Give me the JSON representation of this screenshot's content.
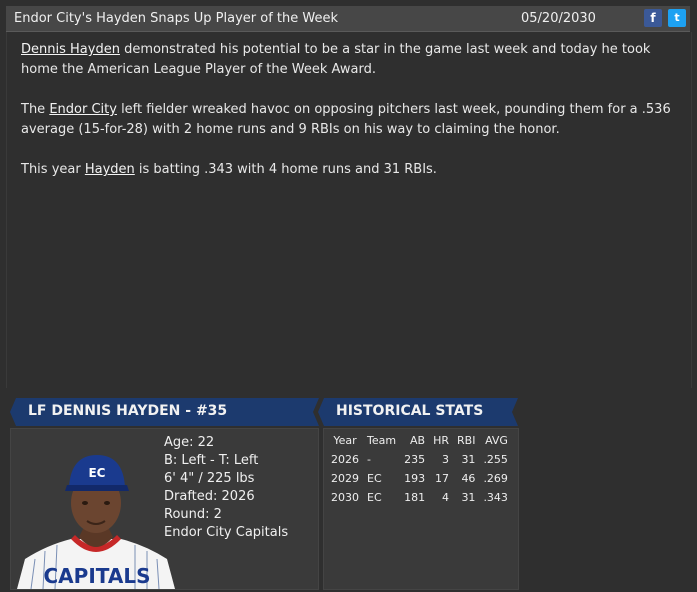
{
  "header": {
    "title": "Endor City's Hayden Snaps Up Player of the Week",
    "date": "05/20/2030",
    "facebook_icon": "f",
    "twitter_icon": "t"
  },
  "article": {
    "p1_link": "Dennis Hayden",
    "p1_text": " demonstrated his potential to be a star in the game last week and today he took home the American League Player of the Week Award.",
    "p2_pre": "The ",
    "p2_link": "Endor City",
    "p2_text": " left fielder wreaked havoc on opposing pitchers last week, pounding them for a .536 average (15-for-28) with 2 home runs and 9 RBIs on his way to claiming the honor.",
    "p3_pre": "This year ",
    "p3_link": "Hayden",
    "p3_text": " is batting .343 with 4 home runs and 31 RBIs."
  },
  "player": {
    "banner": "LF DENNIS HAYDEN - #35",
    "age": "Age: 22",
    "bats_throws": "B: Left - T: Left",
    "height_weight": "6' 4\" / 225 lbs",
    "drafted": "Drafted: 2026",
    "round": "Round: 2",
    "team": "Endor City Capitals",
    "cap_logo": "EC",
    "jersey_text": "CAPITALS"
  },
  "stats": {
    "banner": "HISTORICAL STATS",
    "headers": [
      "Year",
      "Team",
      "AB",
      "HR",
      "RBI",
      "AVG"
    ],
    "rows": [
      [
        "2026",
        "-",
        "235",
        "3",
        "31",
        ".255"
      ],
      [
        "2029",
        "EC",
        "193",
        "17",
        "46",
        ".269"
      ],
      [
        "2030",
        "EC",
        "181",
        "4",
        "31",
        ".343"
      ]
    ]
  }
}
